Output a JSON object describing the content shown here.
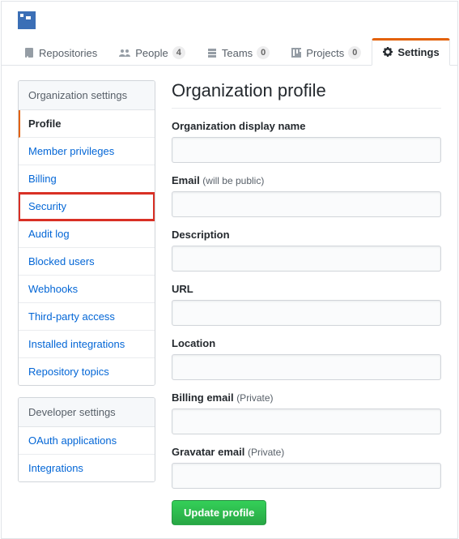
{
  "tabs": {
    "repositories": {
      "label": "Repositories"
    },
    "people": {
      "label": "People",
      "count": "4"
    },
    "teams": {
      "label": "Teams",
      "count": "0"
    },
    "projects": {
      "label": "Projects",
      "count": "0"
    },
    "settings": {
      "label": "Settings"
    }
  },
  "sidebar": {
    "org_header": "Organization settings",
    "items": [
      "Profile",
      "Member privileges",
      "Billing",
      "Security",
      "Audit log",
      "Blocked users",
      "Webhooks",
      "Third-party access",
      "Installed integrations",
      "Repository topics"
    ],
    "dev_header": "Developer settings",
    "dev_items": [
      "OAuth applications",
      "Integrations"
    ]
  },
  "main": {
    "title": "Organization profile",
    "fields": {
      "display_name": {
        "label": "Organization display name",
        "value": ""
      },
      "email": {
        "label": "Email ",
        "hint": "(will be public)",
        "value": ""
      },
      "description": {
        "label": "Description",
        "value": ""
      },
      "url": {
        "label": "URL",
        "value": ""
      },
      "location": {
        "label": "Location",
        "value": ""
      },
      "billing": {
        "label": "Billing email ",
        "hint": "(Private)",
        "value": ""
      },
      "gravatar": {
        "label": "Gravatar email ",
        "hint": "(Private)",
        "value": ""
      }
    },
    "submit": "Update profile"
  }
}
